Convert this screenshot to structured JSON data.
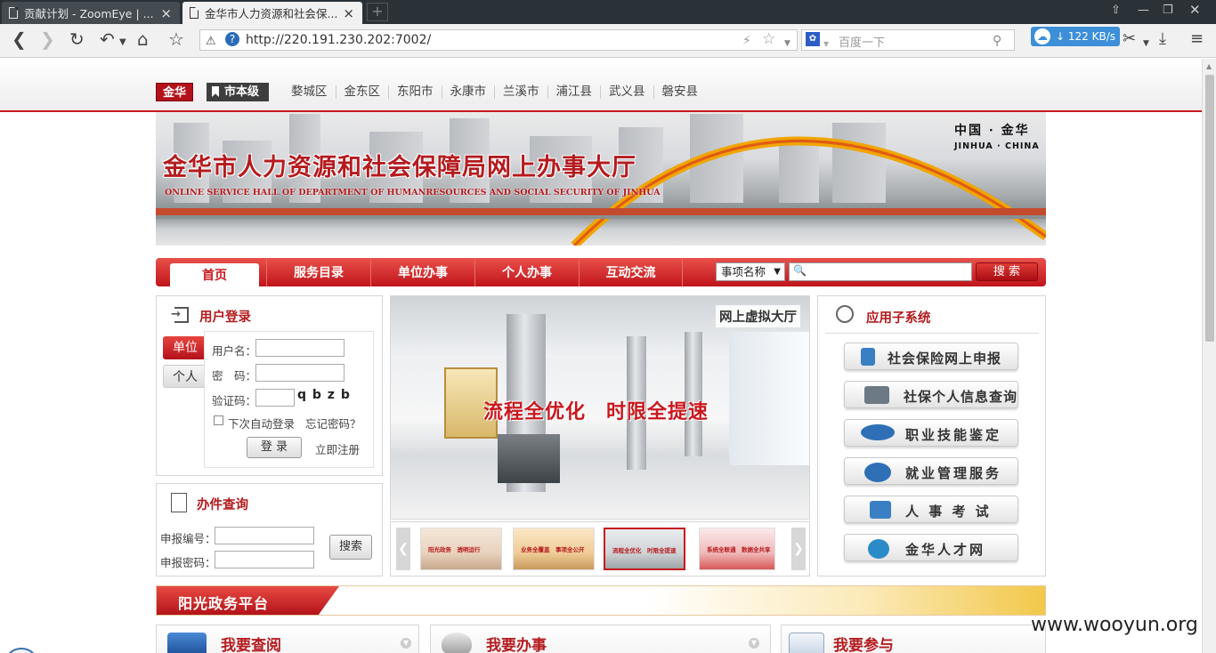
{
  "browser": {
    "tabs": [
      {
        "title": "贡献计划 - ZoomEye | ..."
      },
      {
        "title": "金华市人力资源和社会保..."
      }
    ],
    "url": "http://220.191.230.202:7002/",
    "search_placeholder": "百度一下",
    "download_speed": "122 KB/s"
  },
  "region_bar": {
    "logo": "金华",
    "current": "市本级",
    "regions": [
      "婺城区",
      "金东区",
      "东阳市",
      "永康市",
      "兰溪市",
      "浦江县",
      "武义县",
      "磐安县"
    ]
  },
  "banner": {
    "title": "金华市人力资源和社会保障局网上办事大厅",
    "subtitle": "ONLINE SERVICE HALL OF DEPARTMENT OF HUMANRESOURCES AND SOCIAL SECURITY OF JINHUA",
    "china_cn": "中国 · 金华",
    "china_en": "JINHUA · CHINA"
  },
  "nav": {
    "home": "首页",
    "items": [
      "服务目录",
      "单位办事",
      "个人办事",
      "互动交流"
    ],
    "search_type": "事项名称",
    "search_icon_glyph": "🔍",
    "search_button": "搜 索"
  },
  "login": {
    "title": "用户登录",
    "tab_unit": "单位",
    "tab_person": "个人",
    "username_label": "用户名：",
    "password_label": "密　码：",
    "captcha_label": "验证码：",
    "captcha_value": "q b z b",
    "remember_label": "下次自动登录",
    "forgot_link": "忘记密码？",
    "login_button": "登 录",
    "register_link": "立即注册"
  },
  "query": {
    "title": "办件查询",
    "number_label": "申报编号：",
    "password_label": "申报密码：",
    "search_button": "搜索"
  },
  "hall": {
    "label": "网上虚拟大厅",
    "slogan": "流程全优化　时限全提速",
    "thumbs": [
      "阳光政务　透明运行",
      "业务全覆盖　事项全公开",
      "流程全优化　时限全提速",
      "系统全联通　数据全共享"
    ]
  },
  "apps": {
    "title": "应用子系统",
    "items": [
      {
        "label": "社会保险网上申报",
        "icon": "social-insurance-icon",
        "color": "#3a7fc4"
      },
      {
        "label": "社保个人信息查询",
        "icon": "id-card-icon",
        "color": "#6c7a86"
      },
      {
        "label": "职业技能鉴定",
        "icon": "ztis-logo-icon",
        "color": "#2f6fb5"
      },
      {
        "label": "就业管理服务",
        "icon": "si-logo-icon",
        "color": "#2f6fb5"
      },
      {
        "label": "人 事 考 试",
        "icon": "exam-icon",
        "color": "#3a7fc4"
      },
      {
        "label": "金华人才网",
        "icon": "talent-net-icon",
        "color": "#2a8bc8"
      }
    ]
  },
  "sunshine": {
    "title": "阳光政务平台"
  },
  "bottom": [
    {
      "title": "我要查阅",
      "icon": "laptop-icon"
    },
    {
      "title": "我要办事",
      "icon": "mouse-icon"
    },
    {
      "title": "我要参与",
      "icon": "envelope-icon"
    }
  ],
  "watermark": "www.wooyun.org",
  "colors": {
    "brand_red": "#c8171e",
    "title_red": "#b41b1f"
  }
}
